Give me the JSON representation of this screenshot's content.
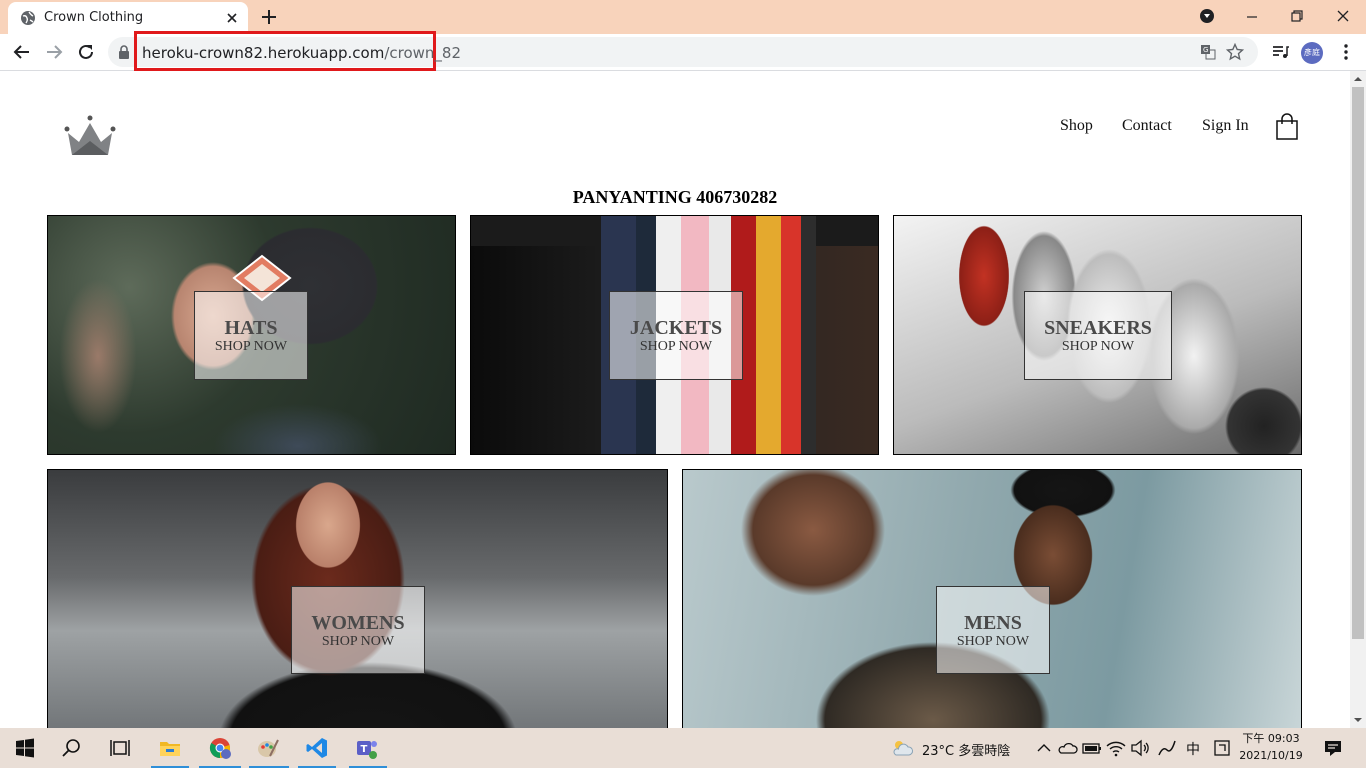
{
  "browser": {
    "tab_title": "Crown Clothing",
    "url_host": "heroku-crown82.herokuapp.com",
    "url_path": "/crown_82",
    "avatar_text": "彥庭",
    "accent_highlight": "#e0191b"
  },
  "site": {
    "nav": {
      "shop": "Shop",
      "contact": "Contact",
      "sign_in": "Sign In"
    },
    "heading": "PANYANTING 406730282",
    "categories": [
      {
        "title": "HATS",
        "subtitle": "SHOP NOW"
      },
      {
        "title": "JACKETS",
        "subtitle": "SHOP NOW"
      },
      {
        "title": "SNEAKERS",
        "subtitle": "SHOP NOW"
      },
      {
        "title": "WOMENS",
        "subtitle": "SHOP NOW"
      },
      {
        "title": "MENS",
        "subtitle": "SHOP NOW"
      }
    ]
  },
  "taskbar": {
    "weather": "23°C  多雲時陰",
    "ime": "中",
    "time": "下午 09:03",
    "date": "2021/10/19"
  }
}
